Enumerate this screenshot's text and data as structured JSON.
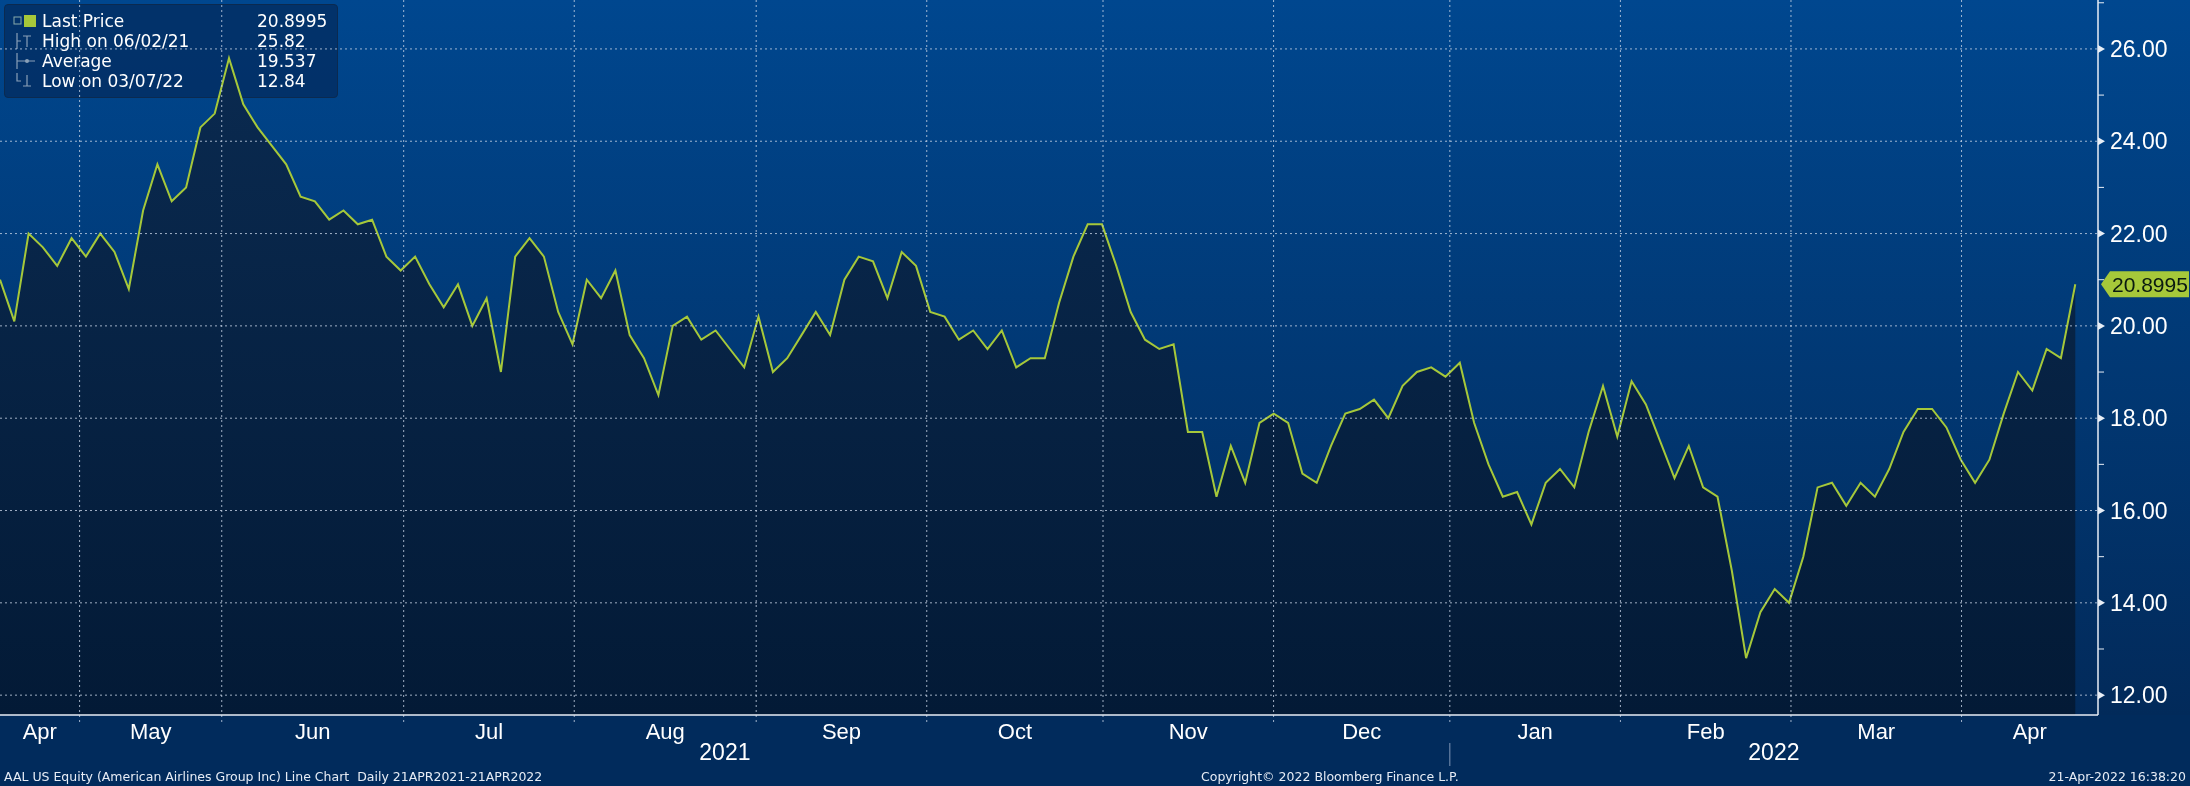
{
  "legend": [
    {
      "kind": "last",
      "value": "20.8995",
      "color": "#a6c83a"
    },
    {
      "kind": "high",
      "label": "High on 06/02/21",
      "value": "25.82"
    },
    {
      "kind": "average",
      "label": "Average",
      "value": "19.537"
    },
    {
      "kind": "low",
      "label": "Low on 03/07/22",
      "value": "12.84"
    }
  ],
  "chart": {
    "chart_data": {
      "type": "area",
      "grid": true,
      "ylim": [
        11.57,
        27.06
      ],
      "yticks": [
        {
          "value": 12,
          "label": "12.00"
        },
        {
          "value": 14,
          "label": "14.00"
        },
        {
          "value": 16,
          "label": "16.00"
        },
        {
          "value": 18,
          "label": "18.00"
        },
        {
          "value": 20,
          "label": "20.00"
        },
        {
          "value": 22,
          "label": "22.00"
        },
        {
          "value": 24,
          "label": "24.00"
        },
        {
          "value": 26,
          "label": "26.00"
        }
      ],
      "categories": [
        null,
        null,
        null,
        null,
        null,
        null,
        null,
        null,
        null,
        null,
        null,
        null,
        null,
        null,
        null,
        null,
        null,
        null,
        null,
        null,
        null,
        null,
        null,
        null,
        null,
        null,
        null,
        null,
        null,
        null,
        null,
        null,
        null,
        null,
        null,
        null,
        null,
        null,
        null,
        null,
        null,
        null,
        null,
        null,
        null,
        null,
        null,
        null,
        null,
        null,
        null,
        null,
        null,
        null,
        null,
        null,
        null,
        null,
        null,
        null,
        null,
        null,
        null,
        null,
        null,
        null,
        null,
        null,
        null,
        null,
        null,
        null,
        null,
        null,
        null,
        null,
        null,
        null,
        null,
        null,
        null,
        null,
        null,
        null,
        null,
        null,
        null,
        null,
        null,
        null,
        null,
        null,
        null,
        null,
        null,
        null,
        null,
        null,
        null,
        null,
        null,
        null,
        null,
        null,
        null,
        null,
        null,
        null,
        null,
        null,
        null,
        null,
        null,
        null,
        null,
        null,
        null,
        null,
        null,
        null,
        null,
        null,
        null,
        null,
        null,
        null,
        null,
        null,
        null,
        null,
        null,
        null,
        null,
        null,
        null,
        null,
        null,
        null,
        null,
        null,
        null,
        null,
        null,
        null,
        null,
        null
      ],
      "series": [
        {
          "name": "Last Price",
          "color": "#a6c83a",
          "values": [
            21.0,
            20.1,
            22.0,
            21.7,
            21.3,
            21.9,
            21.5,
            22.0,
            21.6,
            20.8,
            22.5,
            23.5,
            22.7,
            23.0,
            24.3,
            24.6,
            25.8,
            24.8,
            24.3,
            23.9,
            23.5,
            22.8,
            22.7,
            22.3,
            22.5,
            22.2,
            22.3,
            21.5,
            21.2,
            21.5,
            20.9,
            20.4,
            20.9,
            20.0,
            20.6,
            19.0,
            21.5,
            21.9,
            21.5,
            20.3,
            19.6,
            21.0,
            20.6,
            21.2,
            19.8,
            19.3,
            18.5,
            20.0,
            20.2,
            19.7,
            19.9,
            19.5,
            19.1,
            20.2,
            19.0,
            19.3,
            19.8,
            20.3,
            19.8,
            21.0,
            21.5,
            21.4,
            20.6,
            21.6,
            21.3,
            20.3,
            20.2,
            19.7,
            19.9,
            19.5,
            19.9,
            19.1,
            19.3,
            19.3,
            20.5,
            21.5,
            22.2,
            22.2,
            21.3,
            20.3,
            19.7,
            19.5,
            19.6,
            17.7,
            17.7,
            16.3,
            17.4,
            16.6,
            17.9,
            18.1,
            17.9,
            16.8,
            16.6,
            17.4,
            18.1,
            18.2,
            18.4,
            18.0,
            18.7,
            19.0,
            19.1,
            18.9,
            19.2,
            17.9,
            17.0,
            16.3,
            16.4,
            15.7,
            16.6,
            16.9,
            16.5,
            17.7,
            18.7,
            17.6,
            18.8,
            18.3,
            17.5,
            16.7,
            17.4,
            16.5,
            16.3,
            14.7,
            12.8,
            13.8,
            14.3,
            14.0,
            15.0,
            16.5,
            16.6,
            16.1,
            16.6,
            16.3,
            16.9,
            17.7,
            18.2,
            18.2,
            17.8,
            17.1,
            16.6,
            17.1,
            18.1,
            19.0,
            18.6,
            19.5,
            19.3,
            20.9
          ]
        }
      ],
      "annotations": [
        {
          "text": "20.8995"
        }
      ]
    },
    "months": [
      {
        "label": "Apr"
      },
      {
        "label": "May"
      },
      {
        "label": "Jun"
      },
      {
        "label": "Jul"
      },
      {
        "label": "Aug"
      },
      {
        "label": "Sep"
      },
      {
        "label": "Oct"
      },
      {
        "label": "Nov"
      },
      {
        "label": "Dec"
      },
      {
        "label": "Jan"
      },
      {
        "label": "Feb"
      },
      {
        "label": "Mar"
      },
      {
        "label": "Apr"
      }
    ],
    "years": [
      {
        "label": "2021"
      },
      {
        "label": "2022"
      }
    ]
  },
  "footer": {
    "left": "AAL US Equity (American Airlines Group Inc) Line Chart  Daily 21APR2021-21APR2022",
    "center": "Copyright© 2022 Bloomberg Finance L.P.",
    "right": "21-Apr-2022 16:38:20"
  }
}
